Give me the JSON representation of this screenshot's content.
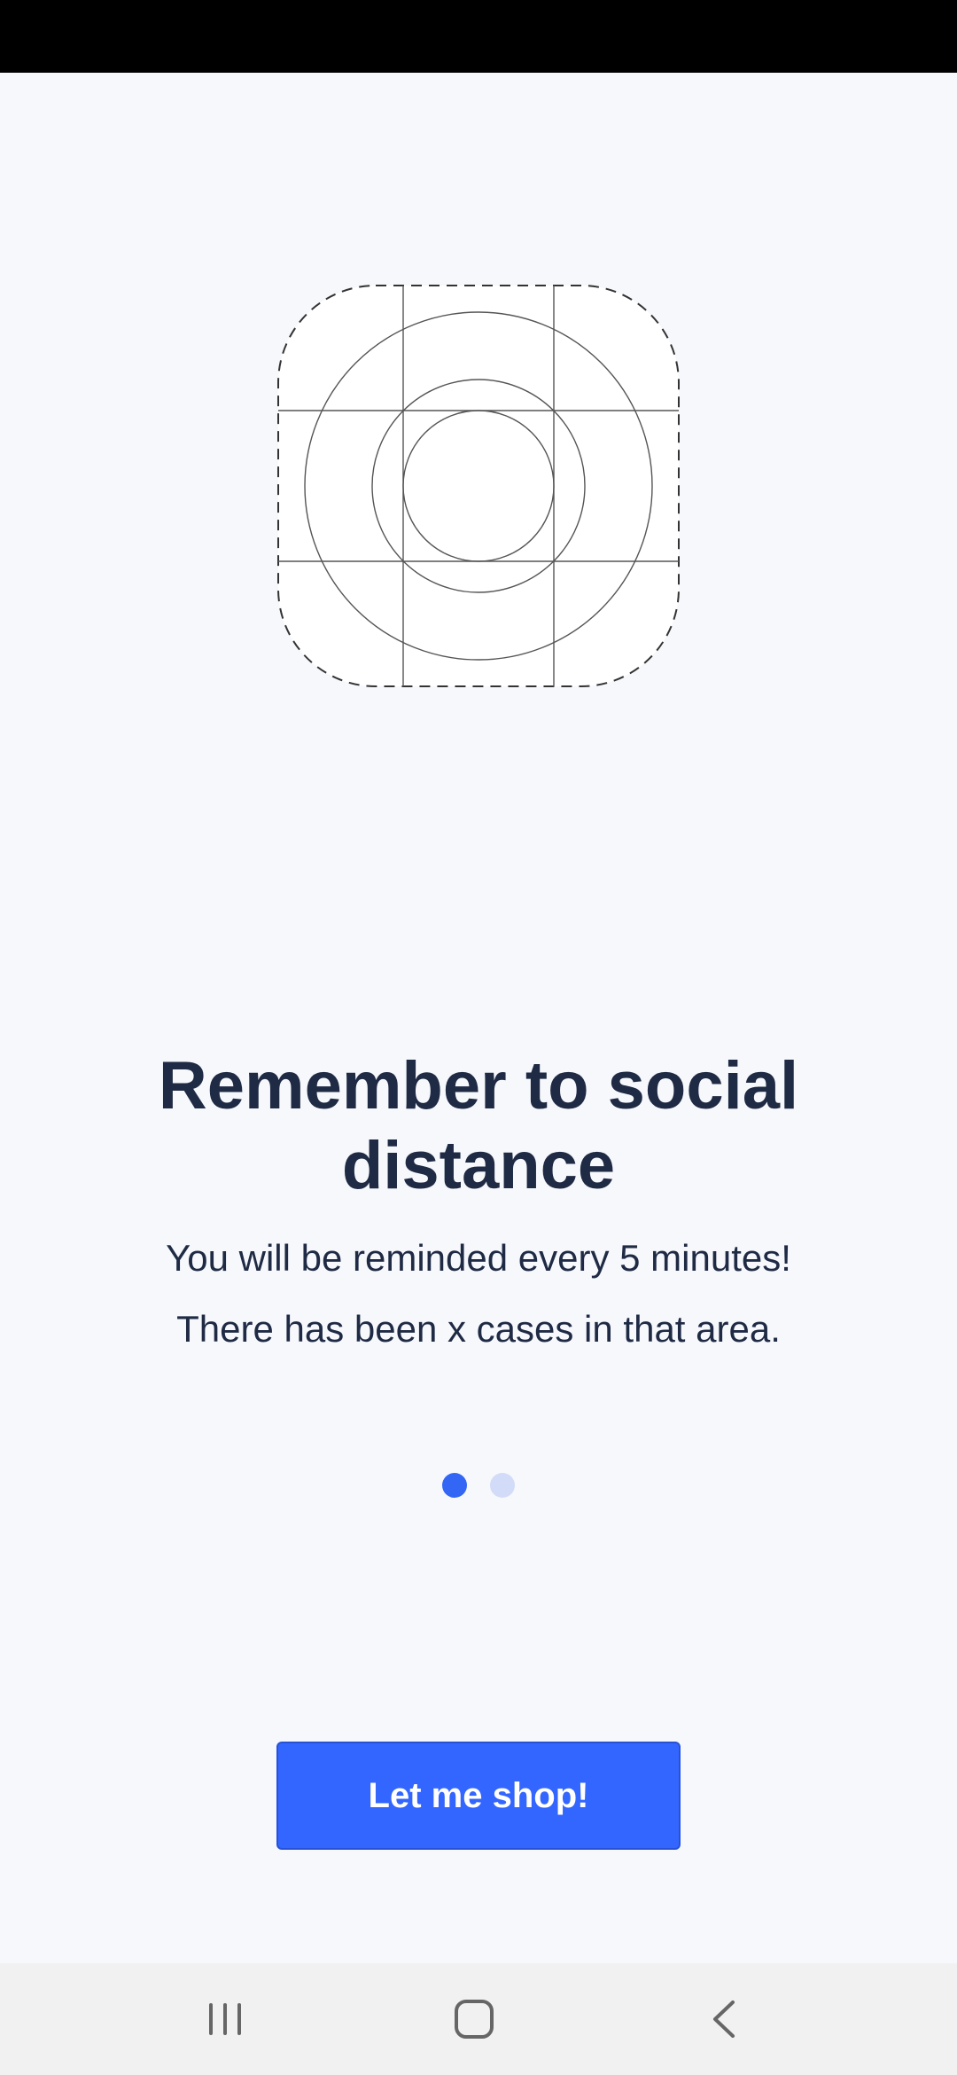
{
  "onboarding": {
    "title": "Remember to social distance",
    "subtitle_line1": "You will be reminded every 5 minutes!",
    "subtitle_line2": "There has been x cases in that area.",
    "pager": {
      "page_count": 2,
      "current_page": 1
    },
    "cta_label": "Let me shop!"
  },
  "navigation_bar": {
    "buttons": [
      "recents-icon",
      "home-icon",
      "back-icon"
    ]
  },
  "colors": {
    "background": "#f6f8fc",
    "text": "#1f2a44",
    "accent": "#3366ff",
    "dot_active": "#3366f5",
    "dot_inactive": "#d2dcf8",
    "status_bar": "#000000",
    "nav_bar": "#f1f1f1"
  }
}
